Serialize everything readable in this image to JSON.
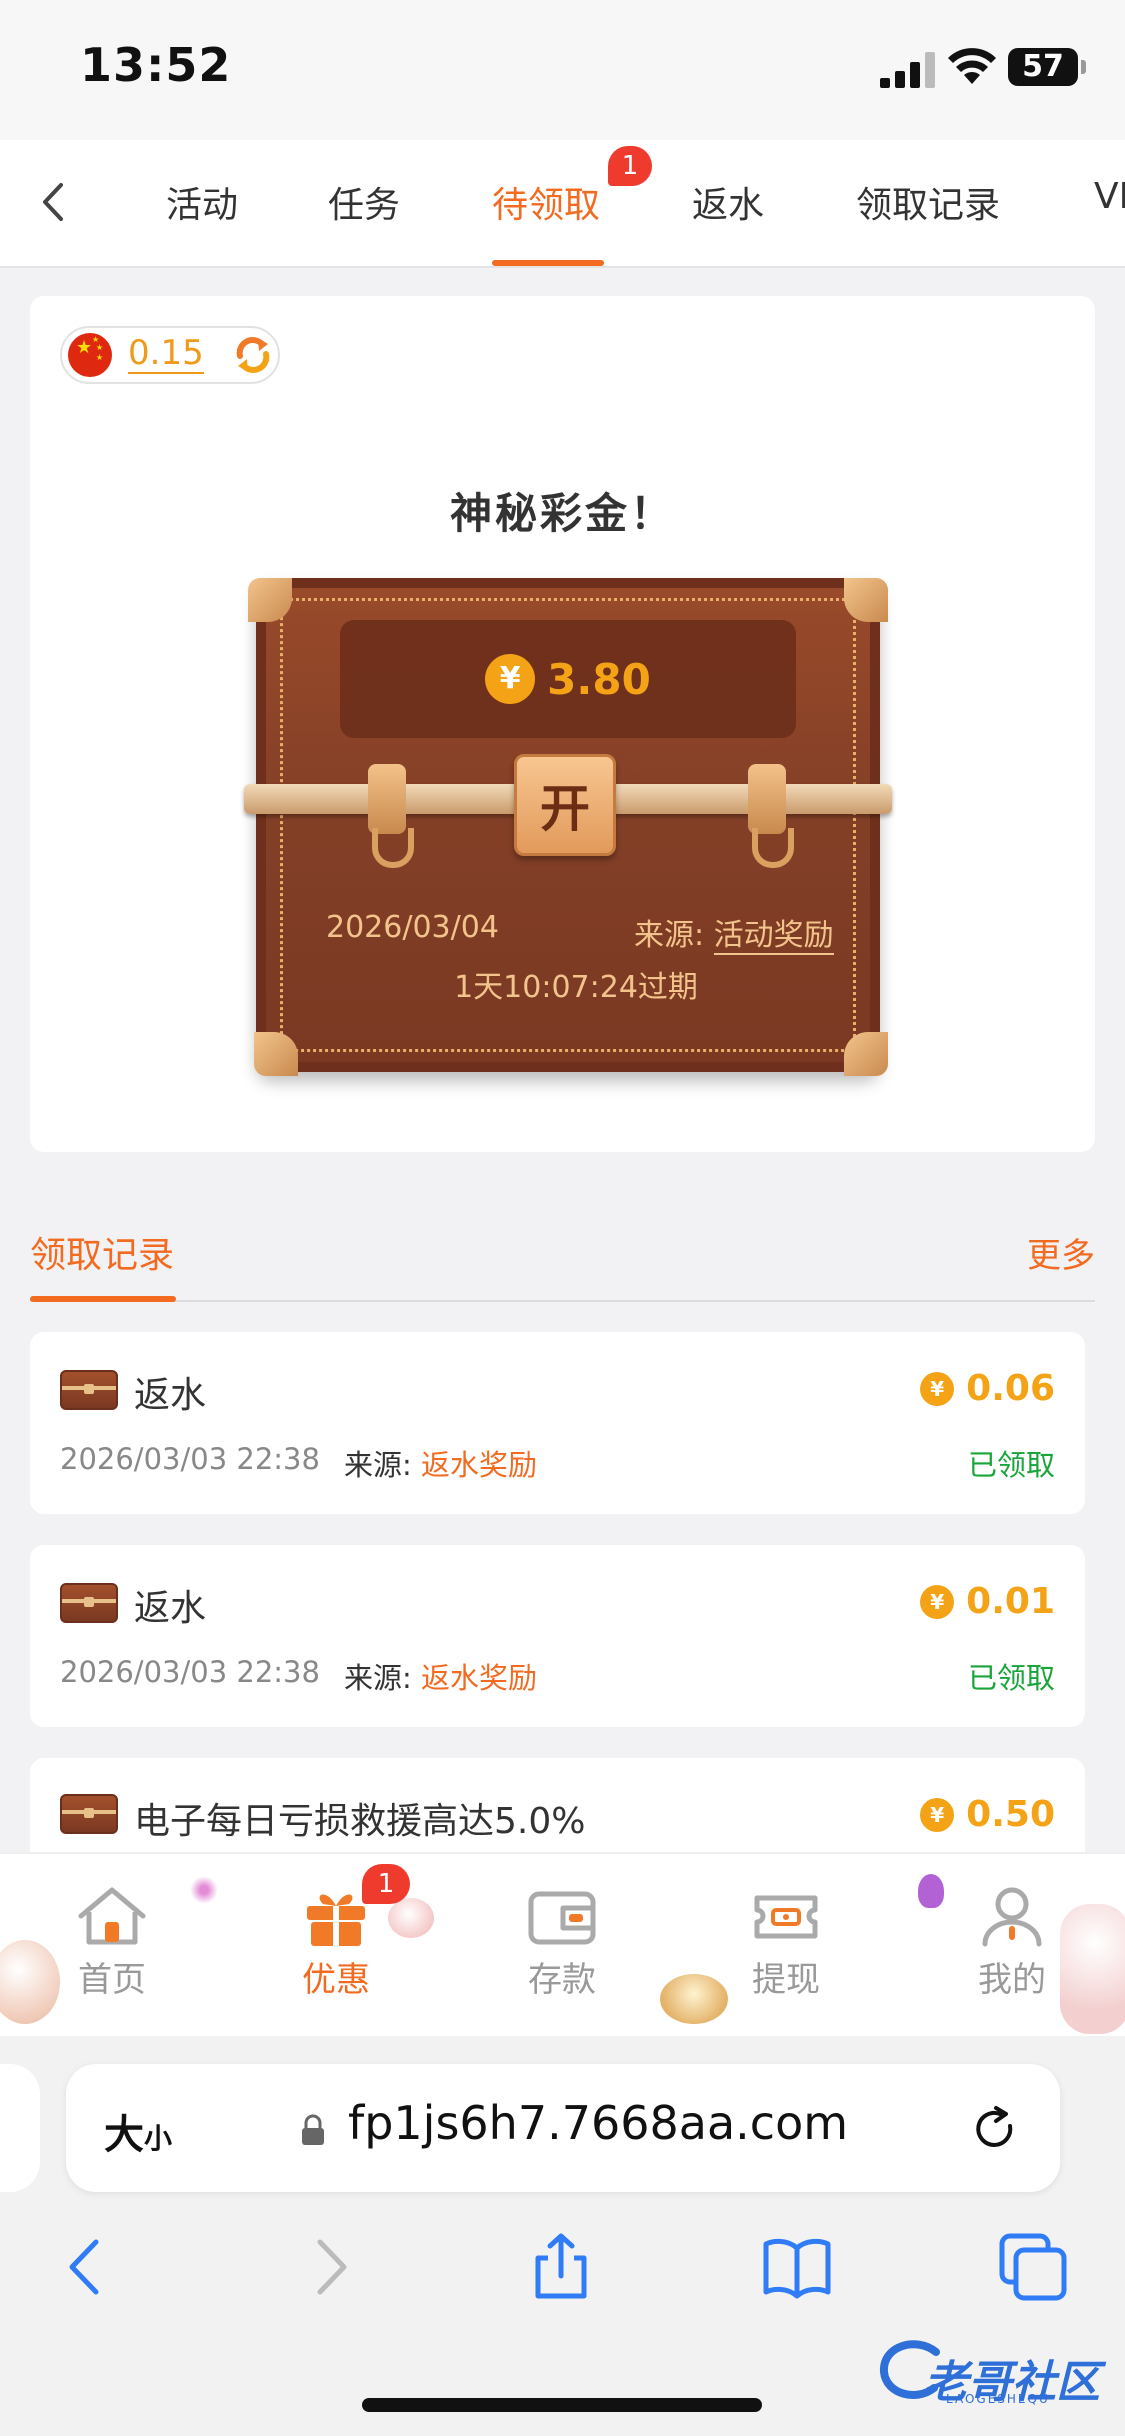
{
  "status_bar": {
    "time": "13:52",
    "battery": "57"
  },
  "tabs": {
    "items": [
      {
        "label": "活动"
      },
      {
        "label": "任务"
      },
      {
        "label": "待领取",
        "badge": "1",
        "active": true
      },
      {
        "label": "返水"
      },
      {
        "label": "领取记录"
      },
      {
        "label": "VI"
      }
    ]
  },
  "mystery": {
    "balance": "0.15",
    "title": "神秘彩金！",
    "currency_symbol": "¥",
    "amount": "3.80",
    "open_label": "开",
    "date": "2026/03/04",
    "source_label": "来源:",
    "source_value": "活动奖励",
    "expiry": "1天10:07:24过期"
  },
  "records": {
    "title": "领取记录",
    "more": "更多",
    "items": [
      {
        "title": "返水",
        "amount": "0.06",
        "datetime": "2026/03/03 22:38",
        "source_label": "来源:",
        "source_value": "返水奖励",
        "status": "已领取"
      },
      {
        "title": "返水",
        "amount": "0.01",
        "datetime": "2026/03/03 22:38",
        "source_label": "来源:",
        "source_value": "返水奖励",
        "status": "已领取"
      },
      {
        "title": "电子每日亏损救援高达5.0%",
        "amount": "0.50"
      }
    ]
  },
  "bottom_nav": {
    "items": [
      {
        "label": "首页",
        "icon": "home-icon"
      },
      {
        "label": "优惠",
        "icon": "gift-icon",
        "badge": "1",
        "active": true
      },
      {
        "label": "存款",
        "icon": "wallet-icon"
      },
      {
        "label": "提现",
        "icon": "withdraw-ticket-icon"
      },
      {
        "label": "我的",
        "icon": "user-icon"
      }
    ]
  },
  "browser": {
    "text_size_label": "大",
    "text_size_small": "小",
    "url": "fp1js6h7.7668aa.com"
  },
  "watermark": {
    "title": "老哥社区",
    "subtitle": "LAOGESHEQU"
  },
  "colors": {
    "accent": "#f26b21",
    "gold": "#f5a316",
    "success": "#19a53a",
    "badge": "#ee3b2e"
  }
}
